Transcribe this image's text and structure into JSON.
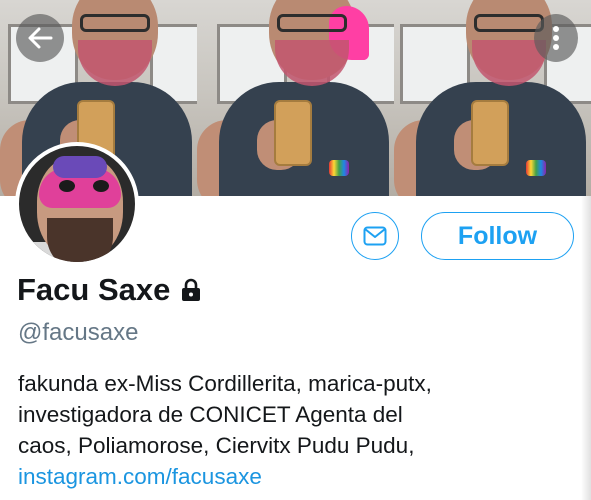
{
  "header": {
    "panels": [
      "photo-1",
      "photo-2",
      "photo-3"
    ]
  },
  "nav": {
    "back_icon": "arrow-left-icon",
    "more_icon": "more-vertical-icon"
  },
  "profile": {
    "display_name": "Facu Saxe",
    "protected_icon": "lock-icon",
    "handle": "@facusaxe",
    "bio_lines": [
      "fakunda ex-Miss Cordillerita, marica-putx,",
      "investigadora de CONICET Agenta del",
      "caos, Poliamorose, Ciervitx Pudu Pudu,"
    ],
    "link": "instagram.com/facusaxe"
  },
  "actions": {
    "message_icon": "envelope-icon",
    "follow_label": "Follow"
  },
  "colors": {
    "accent": "#1da1f2",
    "link": "#1b95e0",
    "text": "#14171a",
    "muted": "#657786"
  }
}
